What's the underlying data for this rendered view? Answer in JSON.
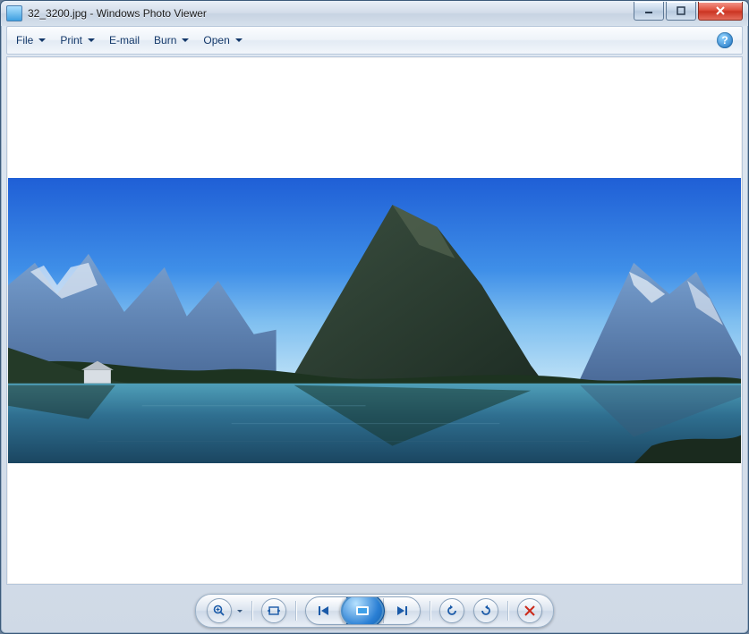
{
  "title": "32_3200.jpg - Windows Photo Viewer",
  "menu": {
    "file": "File",
    "print": "Print",
    "email": "E-mail",
    "burn": "Burn",
    "open": "Open"
  },
  "icons": {
    "help": "?"
  },
  "controls": {
    "zoom": "zoom",
    "fit": "fit-to-window",
    "prev": "previous",
    "play": "slideshow",
    "next": "next",
    "rotate_ccw": "rotate-counterclockwise",
    "rotate_cw": "rotate-clockwise",
    "delete": "delete"
  },
  "image_alt": "Panoramic landscape photo of mountains and a lake under a blue sky"
}
